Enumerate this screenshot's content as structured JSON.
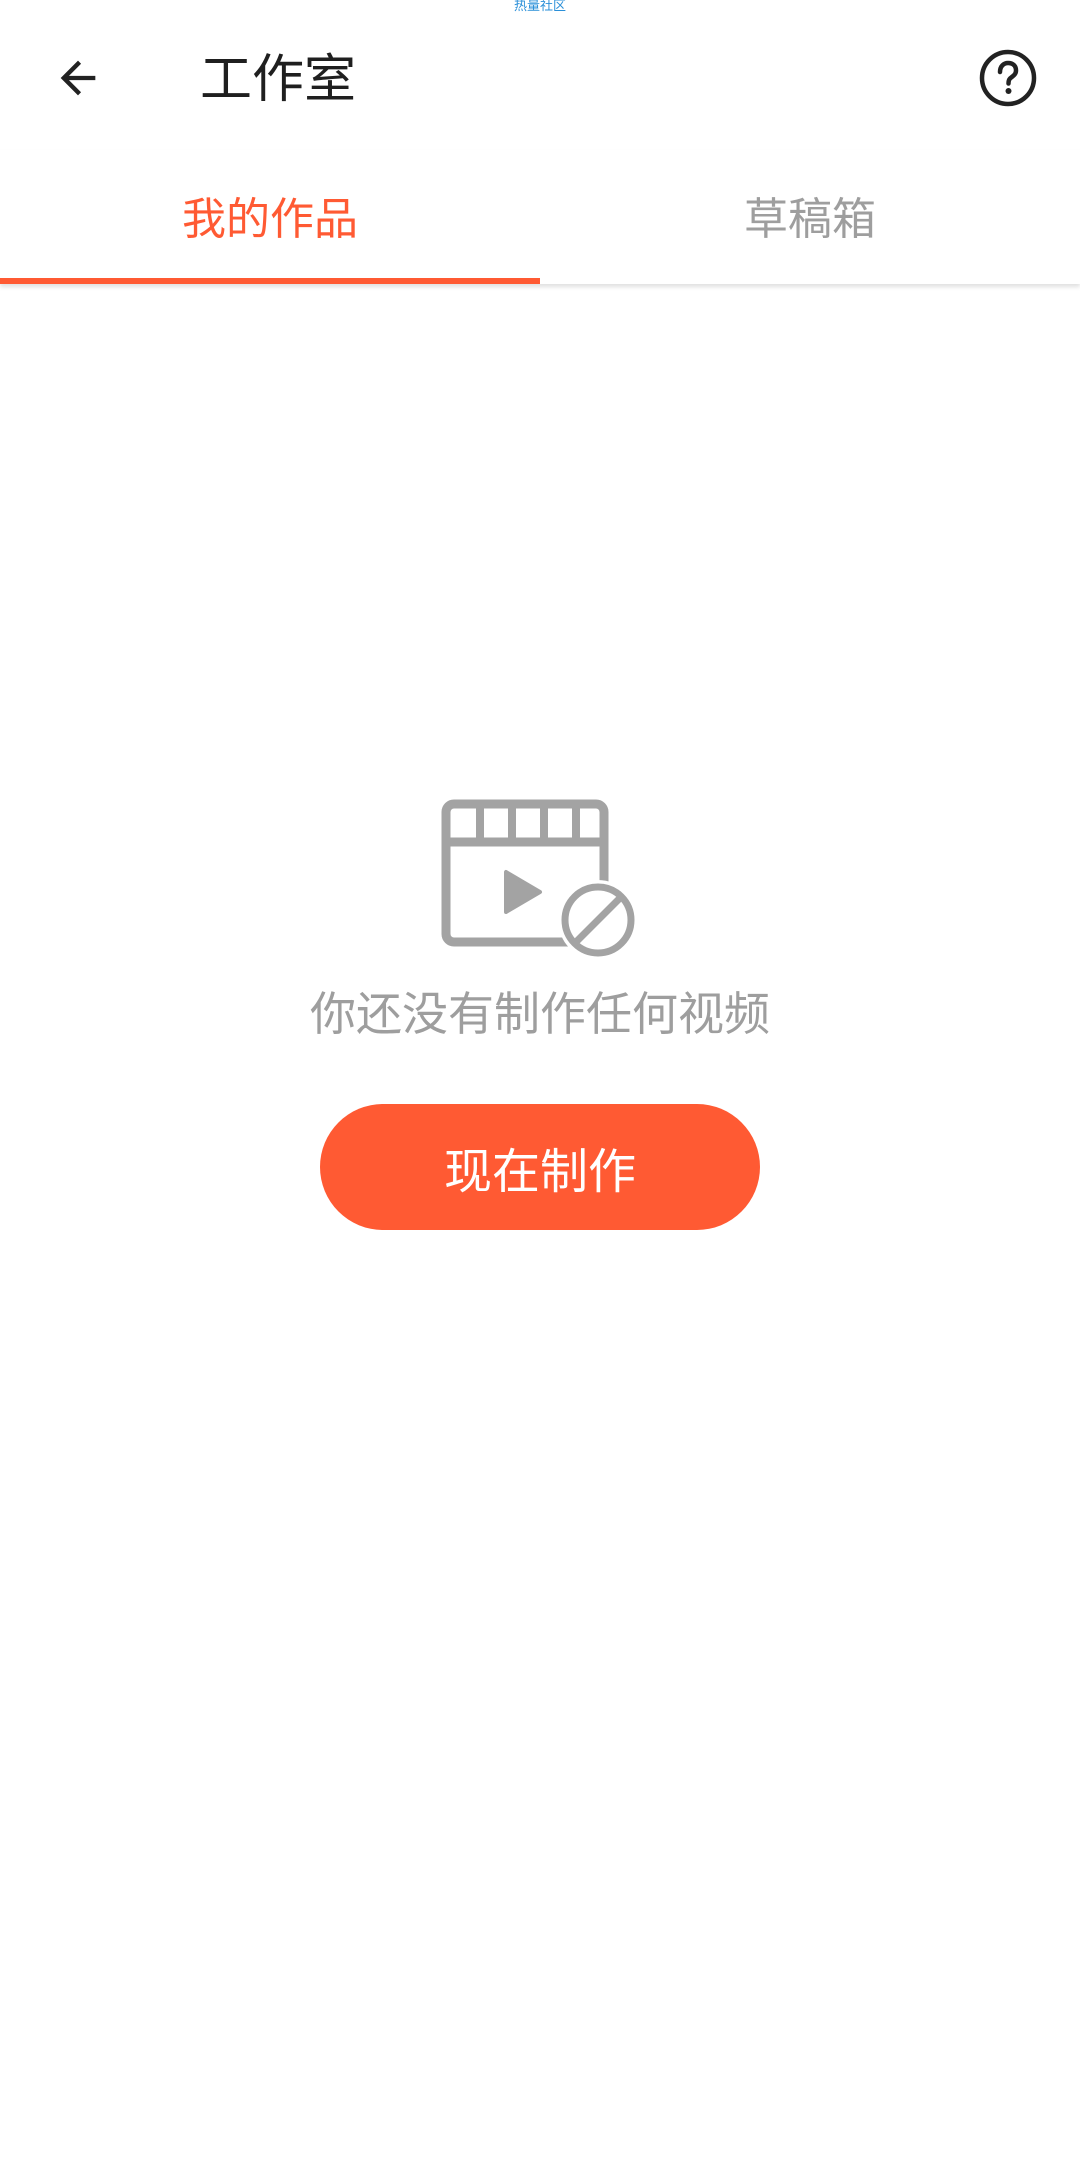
{
  "watermark": "热量社区",
  "appbar": {
    "title": "工作室",
    "back_icon": "arrow-left-icon",
    "help_icon": "question-circle-icon"
  },
  "tabs": [
    {
      "label": "我的作品",
      "active": true
    },
    {
      "label": "草稿箱",
      "active": false
    }
  ],
  "empty_state": {
    "icon": "video-blocked-icon",
    "message": "你还没有制作任何视频",
    "button_label": "现在制作"
  },
  "colors": {
    "accent": "#ff5a33",
    "muted_text": "#9e9e9e",
    "icon_gray": "#a3a3a3",
    "title_text": "#1f1f1f"
  }
}
